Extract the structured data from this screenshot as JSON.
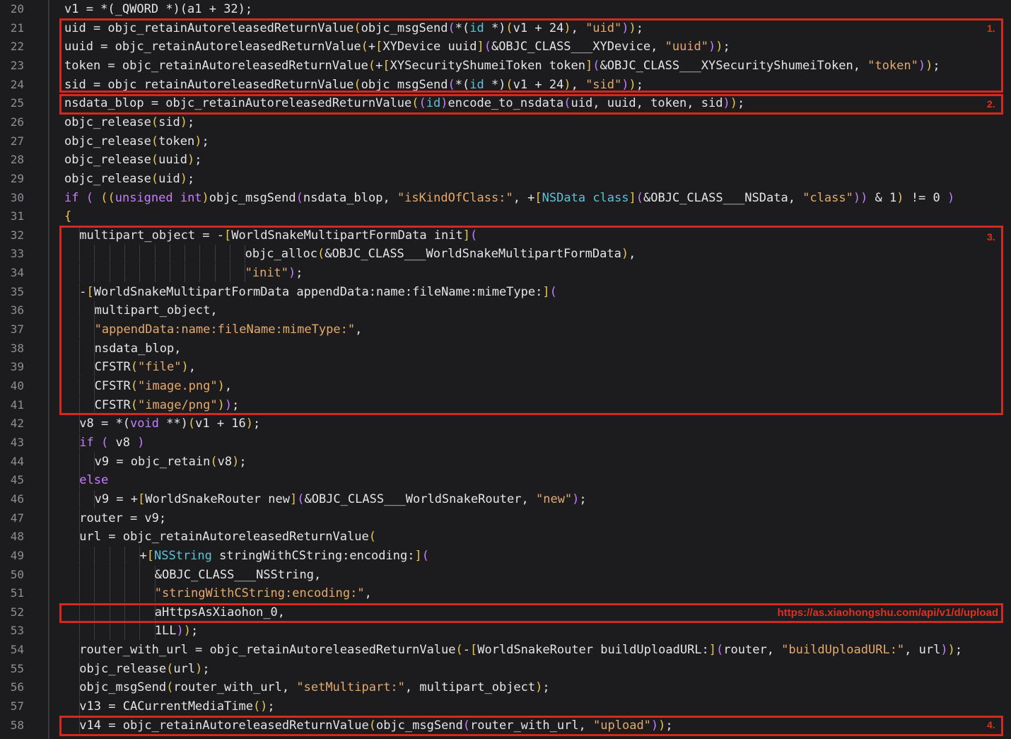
{
  "colors": {
    "background": "#1c1c1e",
    "highlight_box": "#d6281f",
    "keyword": "#c77dff",
    "string": "#e6a96b",
    "class": "#5ec2d6",
    "bracket": "#e8c64f"
  },
  "lines": [
    {
      "n": "20",
      "indent": 0,
      "tokens": [
        [
          "p",
          "v1 = *("
        ],
        [
          "n",
          "_QWORD"
        ],
        [
          "p",
          " *)(a1 + 32);"
        ]
      ]
    },
    {
      "n": "21",
      "indent": 0,
      "tokens": [
        [
          "p",
          "uid = objc_retainAutoreleasedReturnValue"
        ],
        [
          "y",
          "("
        ],
        [
          "p",
          "objc_msgSend"
        ],
        [
          "k",
          "("
        ],
        [
          "p",
          "*("
        ],
        [
          "c",
          "id"
        ],
        [
          "p",
          " *)"
        ],
        [
          "y",
          "("
        ],
        [
          "p",
          "v1 + 24"
        ],
        [
          "y",
          ")"
        ],
        [
          "p",
          ", "
        ],
        [
          "s",
          "\"uid\""
        ],
        [
          "k",
          ")"
        ],
        [
          "y",
          ")"
        ],
        [
          "p",
          ";"
        ]
      ]
    },
    {
      "n": "22",
      "indent": 0,
      "tokens": [
        [
          "p",
          "uuid = objc_retainAutoreleasedReturnValue"
        ],
        [
          "y",
          "("
        ],
        [
          "p",
          "+"
        ],
        [
          "y",
          "["
        ],
        [
          "p",
          "XYDevice uuid"
        ],
        [
          "y",
          "]"
        ],
        [
          "k",
          "("
        ],
        [
          "p",
          "&OBJC_CLASS___XYDevice, "
        ],
        [
          "s",
          "\"uuid\""
        ],
        [
          "k",
          ")"
        ],
        [
          "y",
          ")"
        ],
        [
          "p",
          ";"
        ]
      ]
    },
    {
      "n": "23",
      "indent": 0,
      "tokens": [
        [
          "p",
          "token = objc_retainAutoreleasedReturnValue"
        ],
        [
          "y",
          "("
        ],
        [
          "p",
          "+"
        ],
        [
          "y",
          "["
        ],
        [
          "p",
          "XYSecurityShumeiToken token"
        ],
        [
          "y",
          "]"
        ],
        [
          "k",
          "("
        ],
        [
          "p",
          "&OBJC_CLASS___XYSecurityShumeiToken, "
        ],
        [
          "s",
          "\"token\""
        ],
        [
          "k",
          ")"
        ],
        [
          "y",
          ")"
        ],
        [
          "p",
          ";"
        ]
      ]
    },
    {
      "n": "24",
      "indent": 0,
      "tokens": [
        [
          "p",
          "sid = objc_retainAutoreleasedReturnValue"
        ],
        [
          "y",
          "("
        ],
        [
          "p",
          "objc_msgSend"
        ],
        [
          "k",
          "("
        ],
        [
          "p",
          "*("
        ],
        [
          "c",
          "id"
        ],
        [
          "p",
          " *)"
        ],
        [
          "y",
          "("
        ],
        [
          "p",
          "v1 + 24"
        ],
        [
          "y",
          ")"
        ],
        [
          "p",
          ", "
        ],
        [
          "s",
          "\"sid\""
        ],
        [
          "k",
          ")"
        ],
        [
          "y",
          ")"
        ],
        [
          "p",
          ";"
        ]
      ]
    },
    {
      "n": "25",
      "indent": 0,
      "tokens": [
        [
          "p",
          "nsdata_blop = objc_retainAutoreleasedReturnValue"
        ],
        [
          "y",
          "("
        ],
        [
          "k",
          "("
        ],
        [
          "c",
          "id"
        ],
        [
          "k",
          ")"
        ],
        [
          "p",
          "encode_to_nsdata"
        ],
        [
          "k",
          "("
        ],
        [
          "p",
          "uid, uuid, token, sid"
        ],
        [
          "k",
          ")"
        ],
        [
          "y",
          ")"
        ],
        [
          "p",
          ";"
        ]
      ]
    },
    {
      "n": "26",
      "indent": 0,
      "tokens": [
        [
          "p",
          "objc_release"
        ],
        [
          "y",
          "("
        ],
        [
          "p",
          "sid"
        ],
        [
          "y",
          ")"
        ],
        [
          "p",
          ";"
        ]
      ]
    },
    {
      "n": "27",
      "indent": 0,
      "tokens": [
        [
          "p",
          "objc_release"
        ],
        [
          "y",
          "("
        ],
        [
          "p",
          "token"
        ],
        [
          "y",
          ")"
        ],
        [
          "p",
          ";"
        ]
      ]
    },
    {
      "n": "28",
      "indent": 0,
      "tokens": [
        [
          "p",
          "objc_release"
        ],
        [
          "y",
          "("
        ],
        [
          "p",
          "uuid"
        ],
        [
          "y",
          ")"
        ],
        [
          "p",
          ";"
        ]
      ]
    },
    {
      "n": "29",
      "indent": 0,
      "tokens": [
        [
          "p",
          "objc_release"
        ],
        [
          "y",
          "("
        ],
        [
          "p",
          "uid"
        ],
        [
          "y",
          ")"
        ],
        [
          "p",
          ";"
        ]
      ]
    },
    {
      "n": "30",
      "indent": 0,
      "tokens": [
        [
          "k",
          "if"
        ],
        [
          "p",
          " "
        ],
        [
          "k",
          "("
        ],
        [
          "p",
          " "
        ],
        [
          "y",
          "(("
        ],
        [
          "k",
          "unsigned int"
        ],
        [
          "y",
          ")"
        ],
        [
          "p",
          "objc_msgSend"
        ],
        [
          "k",
          "("
        ],
        [
          "p",
          "nsdata_blop, "
        ],
        [
          "s",
          "\"isKindOfClass:\""
        ],
        [
          "p",
          ", +"
        ],
        [
          "y",
          "["
        ],
        [
          "c",
          "NSData class"
        ],
        [
          "y",
          "]"
        ],
        [
          "k",
          "("
        ],
        [
          "p",
          "&OBJC_CLASS___NSData, "
        ],
        [
          "s",
          "\"class\""
        ],
        [
          "k",
          "))"
        ],
        [
          "p",
          " & 1"
        ],
        [
          "y",
          ")"
        ],
        [
          "p",
          " != 0 "
        ],
        [
          "k",
          ")"
        ]
      ]
    },
    {
      "n": "31",
      "indent": 0,
      "tokens": [
        [
          "y",
          "{"
        ]
      ]
    },
    {
      "n": "32",
      "indent": 1,
      "tokens": [
        [
          "p",
          "multipart_object = -"
        ],
        [
          "y",
          "["
        ],
        [
          "p",
          "WorldSnakeMultipartFormData init"
        ],
        [
          "y",
          "]"
        ],
        [
          "k",
          "("
        ]
      ]
    },
    {
      "n": "33",
      "indent": 12,
      "tokens": [
        [
          "p",
          "objc_alloc"
        ],
        [
          "y",
          "("
        ],
        [
          "p",
          "&OBJC_CLASS___WorldSnakeMultipartFormData"
        ],
        [
          "y",
          ")"
        ],
        [
          "p",
          ","
        ]
      ]
    },
    {
      "n": "34",
      "indent": 12,
      "tokens": [
        [
          "s",
          "\"init\""
        ],
        [
          "k",
          ")"
        ],
        [
          "p",
          ";"
        ]
      ]
    },
    {
      "n": "35",
      "indent": 1,
      "tokens": [
        [
          "p",
          "-"
        ],
        [
          "y",
          "["
        ],
        [
          "p",
          "WorldSnakeMultipartFormData appendData:name:fileName:mimeType:"
        ],
        [
          "y",
          "]"
        ],
        [
          "k",
          "("
        ]
      ]
    },
    {
      "n": "36",
      "indent": 2,
      "tokens": [
        [
          "p",
          "multipart_object,"
        ]
      ]
    },
    {
      "n": "37",
      "indent": 2,
      "tokens": [
        [
          "s",
          "\"appendData:name:fileName:mimeType:\""
        ],
        [
          "p",
          ","
        ]
      ]
    },
    {
      "n": "38",
      "indent": 2,
      "tokens": [
        [
          "p",
          "nsdata_blop,"
        ]
      ]
    },
    {
      "n": "39",
      "indent": 2,
      "tokens": [
        [
          "p",
          "CFSTR"
        ],
        [
          "y",
          "("
        ],
        [
          "s",
          "\"file\""
        ],
        [
          "y",
          ")"
        ],
        [
          "p",
          ","
        ]
      ]
    },
    {
      "n": "40",
      "indent": 2,
      "tokens": [
        [
          "p",
          "CFSTR"
        ],
        [
          "y",
          "("
        ],
        [
          "s",
          "\"image.png\""
        ],
        [
          "y",
          ")"
        ],
        [
          "p",
          ","
        ]
      ]
    },
    {
      "n": "41",
      "indent": 2,
      "tokens": [
        [
          "p",
          "CFSTR"
        ],
        [
          "y",
          "("
        ],
        [
          "s",
          "\"image/png\""
        ],
        [
          "y",
          ")"
        ],
        [
          "k",
          ")"
        ],
        [
          "p",
          ";"
        ]
      ]
    },
    {
      "n": "42",
      "indent": 1,
      "tokens": [
        [
          "p",
          "v8 = *("
        ],
        [
          "k",
          "void"
        ],
        [
          "p",
          " **)"
        ],
        [
          "y",
          "("
        ],
        [
          "p",
          "v1 + 16"
        ],
        [
          "y",
          ")"
        ],
        [
          "p",
          ";"
        ]
      ]
    },
    {
      "n": "43",
      "indent": 1,
      "tokens": [
        [
          "k",
          "if"
        ],
        [
          "p",
          " "
        ],
        [
          "k",
          "("
        ],
        [
          "p",
          " v8 "
        ],
        [
          "k",
          ")"
        ]
      ]
    },
    {
      "n": "44",
      "indent": 2,
      "tokens": [
        [
          "p",
          "v9 = objc_retain"
        ],
        [
          "y",
          "("
        ],
        [
          "p",
          "v8"
        ],
        [
          "y",
          ")"
        ],
        [
          "p",
          ";"
        ]
      ]
    },
    {
      "n": "45",
      "indent": 1,
      "tokens": [
        [
          "k",
          "else"
        ]
      ]
    },
    {
      "n": "46",
      "indent": 2,
      "tokens": [
        [
          "p",
          "v9 = +"
        ],
        [
          "y",
          "["
        ],
        [
          "p",
          "WorldSnakeRouter new"
        ],
        [
          "y",
          "]"
        ],
        [
          "k",
          "("
        ],
        [
          "p",
          "&OBJC_CLASS___WorldSnakeRouter, "
        ],
        [
          "s",
          "\"new\""
        ],
        [
          "k",
          ")"
        ],
        [
          "p",
          ";"
        ]
      ]
    },
    {
      "n": "47",
      "indent": 1,
      "tokens": [
        [
          "p",
          "router = v9;"
        ]
      ]
    },
    {
      "n": "48",
      "indent": 1,
      "tokens": [
        [
          "p",
          "url = objc_retainAutoreleasedReturnValue"
        ],
        [
          "y",
          "("
        ]
      ]
    },
    {
      "n": "49",
      "indent": 5,
      "tokens": [
        [
          "p",
          "+"
        ],
        [
          "y",
          "["
        ],
        [
          "c",
          "NSString"
        ],
        [
          "p",
          " stringWithCString:encoding:"
        ],
        [
          "y",
          "]"
        ],
        [
          "k",
          "("
        ]
      ]
    },
    {
      "n": "50",
      "indent": 6,
      "tokens": [
        [
          "p",
          "&OBJC_CLASS___NSString,"
        ]
      ]
    },
    {
      "n": "51",
      "indent": 6,
      "tokens": [
        [
          "s",
          "\"stringWithCString:encoding:\""
        ],
        [
          "p",
          ","
        ]
      ]
    },
    {
      "n": "52",
      "indent": 6,
      "tokens": [
        [
          "p",
          "aHttpsAsXiaohon_0,"
        ]
      ]
    },
    {
      "n": "53",
      "indent": 6,
      "tokens": [
        [
          "p",
          "1LL"
        ],
        [
          "k",
          ")"
        ],
        [
          "y",
          ")"
        ],
        [
          "p",
          ";"
        ]
      ]
    },
    {
      "n": "54",
      "indent": 1,
      "tokens": [
        [
          "p",
          "router_with_url = objc_retainAutoreleasedReturnValue"
        ],
        [
          "y",
          "("
        ],
        [
          "p",
          "-"
        ],
        [
          "y",
          "["
        ],
        [
          "p",
          "WorldSnakeRouter buildUploadURL:"
        ],
        [
          "y",
          "]"
        ],
        [
          "k",
          "("
        ],
        [
          "p",
          "router, "
        ],
        [
          "s",
          "\"buildUploadURL:\""
        ],
        [
          "p",
          ", url"
        ],
        [
          "k",
          ")"
        ],
        [
          "y",
          ")"
        ],
        [
          "p",
          ";"
        ]
      ]
    },
    {
      "n": "55",
      "indent": 1,
      "tokens": [
        [
          "p",
          "objc_release"
        ],
        [
          "y",
          "("
        ],
        [
          "p",
          "url"
        ],
        [
          "y",
          ")"
        ],
        [
          "p",
          ";"
        ]
      ]
    },
    {
      "n": "56",
      "indent": 1,
      "tokens": [
        [
          "p",
          "objc_msgSend"
        ],
        [
          "y",
          "("
        ],
        [
          "p",
          "router_with_url, "
        ],
        [
          "s",
          "\"setMultipart:\""
        ],
        [
          "p",
          ", multipart_object"
        ],
        [
          "y",
          ")"
        ],
        [
          "p",
          ";"
        ]
      ]
    },
    {
      "n": "57",
      "indent": 1,
      "tokens": [
        [
          "p",
          "v13 = CACurrentMediaTime"
        ],
        [
          "y",
          "()"
        ],
        [
          "p",
          ";"
        ]
      ]
    },
    {
      "n": "58",
      "indent": 1,
      "tokens": [
        [
          "p",
          "v14 = objc_retainAutoreleasedReturnValue"
        ],
        [
          "y",
          "("
        ],
        [
          "p",
          "objc_msgSend"
        ],
        [
          "k",
          "("
        ],
        [
          "p",
          "router_with_url, "
        ],
        [
          "s",
          "\"upload\""
        ],
        [
          "k",
          ")"
        ],
        [
          "y",
          ")"
        ],
        [
          "p",
          ";"
        ]
      ]
    }
  ],
  "annotations": {
    "box1_label": "1.",
    "box2_label": "2.",
    "box3_label": "3.",
    "box4_label": "4.",
    "url_note": "https://as.xiaohongshu.com/api/v1/d/upload"
  }
}
